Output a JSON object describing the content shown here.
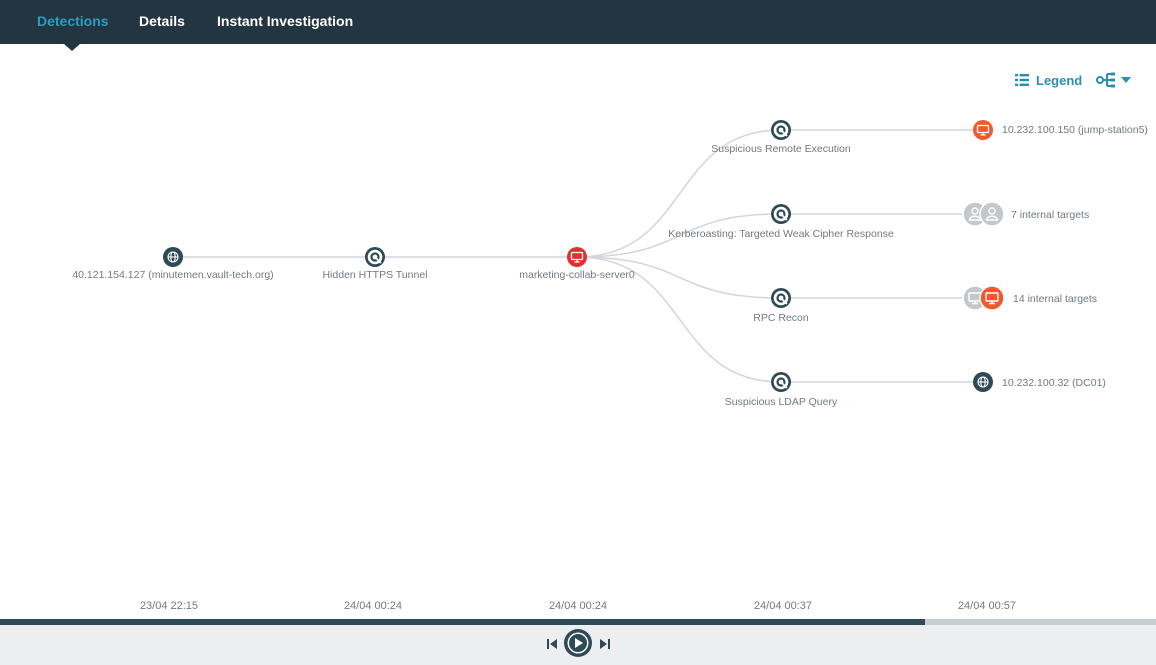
{
  "tabs": [
    {
      "label": "Detections",
      "active": true
    },
    {
      "label": "Details",
      "active": false
    },
    {
      "label": "Instant Investigation",
      "active": false
    }
  ],
  "toolbar": {
    "legend_label": "Legend",
    "legend_icon": "list-icon",
    "layout_icon": "tree-layout-icon"
  },
  "graph": {
    "nodes": [
      {
        "id": "attacker",
        "label": "40.121.154.127 (minutemen.vault-tech.org)",
        "icon": "globe-icon",
        "kind": "external-host"
      },
      {
        "id": "tunnel",
        "label": "Hidden HTTPS Tunnel",
        "icon": "detection-icon",
        "kind": "detection"
      },
      {
        "id": "server",
        "label": "marketing-collab-server0",
        "icon": "monitor-icon",
        "kind": "host-compromised"
      },
      {
        "id": "remote-exec",
        "label": "Suspicious Remote Execution",
        "icon": "detection-icon",
        "kind": "detection"
      },
      {
        "id": "kerberoasting",
        "label": "Kerberoasting: Targeted Weak Cipher Response",
        "icon": "detection-icon",
        "kind": "detection"
      },
      {
        "id": "rpc-recon",
        "label": "RPC Recon",
        "icon": "detection-icon",
        "kind": "detection"
      },
      {
        "id": "ldap-query",
        "label": "Suspicious LDAP Query",
        "icon": "detection-icon",
        "kind": "detection"
      },
      {
        "id": "jump-station",
        "label": "10.232.100.150 (jump-station5)",
        "icon": "monitor-icon",
        "kind": "host-alert"
      },
      {
        "id": "internal-7",
        "label": "7 internal targets",
        "icon": "user-group-icon",
        "kind": "target-group"
      },
      {
        "id": "internal-14",
        "label": "14 internal targets",
        "icon": "monitor-group-icon",
        "kind": "target-group"
      },
      {
        "id": "dc01",
        "label": "10.232.100.32 (DC01)",
        "icon": "globe-icon",
        "kind": "internal-host"
      }
    ],
    "edges": [
      [
        "attacker",
        "tunnel"
      ],
      [
        "tunnel",
        "server"
      ],
      [
        "server",
        "remote-exec"
      ],
      [
        "server",
        "kerberoasting"
      ],
      [
        "server",
        "rpc-recon"
      ],
      [
        "server",
        "ldap-query"
      ],
      [
        "remote-exec",
        "jump-station"
      ],
      [
        "kerberoasting",
        "internal-7"
      ],
      [
        "rpc-recon",
        "internal-14"
      ],
      [
        "ldap-query",
        "dc01"
      ]
    ]
  },
  "timeline": {
    "ticks": [
      "23/04 22:15",
      "24/04 00:24",
      "24/04 00:24",
      "24/04 00:37",
      "24/04 00:57"
    ],
    "progress": 0.8
  },
  "playback": {
    "prev_icon": "skip-back-icon",
    "play_icon": "play-icon",
    "next_icon": "skip-forward-icon"
  },
  "colors": {
    "header_bg": "#233540",
    "accent": "#2e9cc0",
    "node_dark": "#2e4a57",
    "alert_red": "#e23030",
    "alert_orange": "#f0592e",
    "muted_grey": "#c4c8cb"
  }
}
